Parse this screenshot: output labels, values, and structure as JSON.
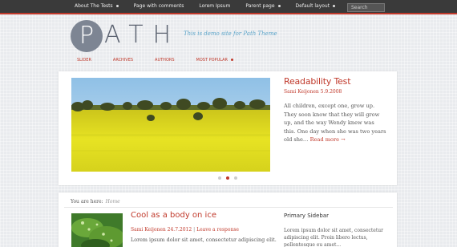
{
  "top_nav": {
    "items": [
      {
        "label": "About The Tests",
        "has_dropdown": true
      },
      {
        "label": "Page with comments",
        "has_dropdown": false
      },
      {
        "label": "Lorem Ipsum",
        "has_dropdown": false
      },
      {
        "label": "Parent page",
        "has_dropdown": true
      },
      {
        "label": "Default layout",
        "has_dropdown": true
      }
    ],
    "search_placeholder": "Search"
  },
  "header": {
    "logo_initial": "P",
    "logo_rest": "ATH",
    "tagline": "This is demo site for Path Theme"
  },
  "main_nav": {
    "items": [
      {
        "label": "Slider"
      },
      {
        "label": "Archives"
      },
      {
        "label": "Authors"
      },
      {
        "label": "Most Popular",
        "has_dropdown": true
      }
    ]
  },
  "feature": {
    "title": "Readability Test",
    "meta": "Sami Keijonen 5.9.2008",
    "excerpt": "All children, except one, grow up. They soon know that they will grow up, and the way Wendy knew was this. One day when she was two years old she…",
    "read_more": "Read more →",
    "slider": {
      "count": 3,
      "active": 2
    },
    "image_alt": "Field of yellow rapeseed under blue sky"
  },
  "breadcrumb": {
    "label": "You are here:",
    "home": "Home"
  },
  "post": {
    "title": "Cool as a body on ice",
    "author_date": "Sami Keijonen 24.7.2012",
    "separator": "|",
    "comments": "Leave a response",
    "excerpt": "Lorem ipsum dolor sit amet, consectetur adipiscing elit."
  },
  "sidebar": {
    "title": "Primary Sidebar",
    "text": "Lorem ipsum dolor sit amet, consectetur adipiscing elit. Proin libero lectus, pellentesque eu amet..."
  },
  "colors": {
    "accent": "#c0392b",
    "topbar": "#3a3a3a",
    "logo_circle": "#7d8593",
    "tagline": "#5aa3c8"
  }
}
